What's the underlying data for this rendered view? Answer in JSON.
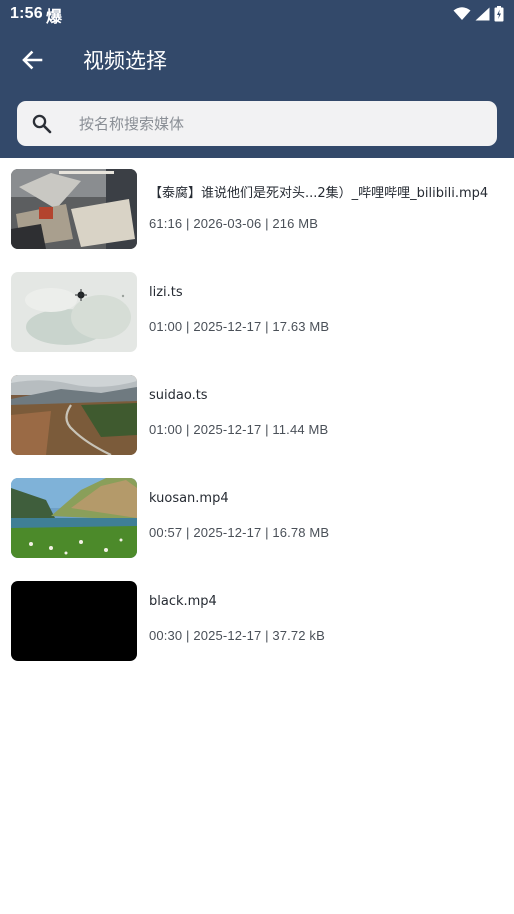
{
  "status_bar": {
    "time": "1:56",
    "extra_glyph": "爆",
    "icons": [
      "wifi-icon",
      "cellular-signal-icon",
      "battery-icon"
    ]
  },
  "toolbar": {
    "title": "视频选择",
    "back_icon": "arrow-back-icon"
  },
  "search": {
    "placeholder": "按名称搜索媒体",
    "value": ""
  },
  "colors": {
    "header": "#33496a",
    "search_bg": "#f2f2f3",
    "text_primary": "#262b33",
    "text_secondary": "#4a5058"
  },
  "media_items": [
    {
      "name": "【泰腐】谁说他们是死对头...2集）_哔哩哔哩_bilibili.mp4",
      "meta": "61:16 | 2026-03-06 | 216 MB"
    },
    {
      "name": "lizi.ts",
      "meta": "01:00 | 2025-12-17 | 17.63 MB"
    },
    {
      "name": "suidao.ts",
      "meta": "01:00 | 2025-12-17 | 11.44 MB"
    },
    {
      "name": "kuosan.mp4",
      "meta": "00:57 | 2025-12-17 | 16.78 MB"
    },
    {
      "name": "black.mp4",
      "meta": "00:30 | 2025-12-17 | 37.72 kB"
    }
  ]
}
